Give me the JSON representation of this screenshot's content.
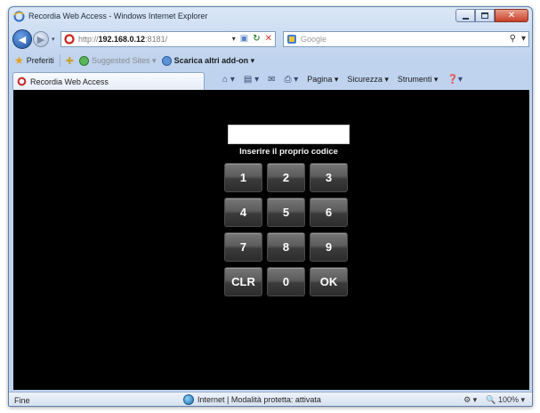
{
  "window": {
    "title": "Recordia Web Access - Windows Internet Explorer",
    "buttons": {
      "minimize": "minimize",
      "maximize": "maximize",
      "close": "close"
    }
  },
  "nav": {
    "address_prefix": "http://",
    "address_host": "192.168.0.12",
    "address_suffix": ":8181/",
    "search_placeholder": "Google"
  },
  "favorites": {
    "favorites_label": "Preferiti",
    "suggested_label": "Suggested Sites ▾",
    "addons_label": "Scarica altri add-on ▾"
  },
  "tab": {
    "label": "Recordia Web Access"
  },
  "commands": {
    "page": "Pagina ▾",
    "safety": "Sicurezza ▾",
    "tools": "Strumenti ▾"
  },
  "keypad": {
    "prompt": "Inserire il proprio codice",
    "code_value": "",
    "keys": [
      "1",
      "2",
      "3",
      "4",
      "5",
      "6",
      "7",
      "8",
      "9",
      "CLR",
      "0",
      "OK"
    ]
  },
  "status": {
    "left": "Fine",
    "zone": "Internet | Modalità protetta: attivata",
    "zoom": "100%"
  },
  "icons": [
    "ie-logo-icon",
    "back-arrow-icon",
    "forward-arrow-icon",
    "refresh-icon",
    "stop-icon",
    "search-icon",
    "favorites-star-icon",
    "home-icon",
    "feeds-icon",
    "print-icon",
    "help-icon",
    "globe-icon",
    "zoom-icon"
  ]
}
